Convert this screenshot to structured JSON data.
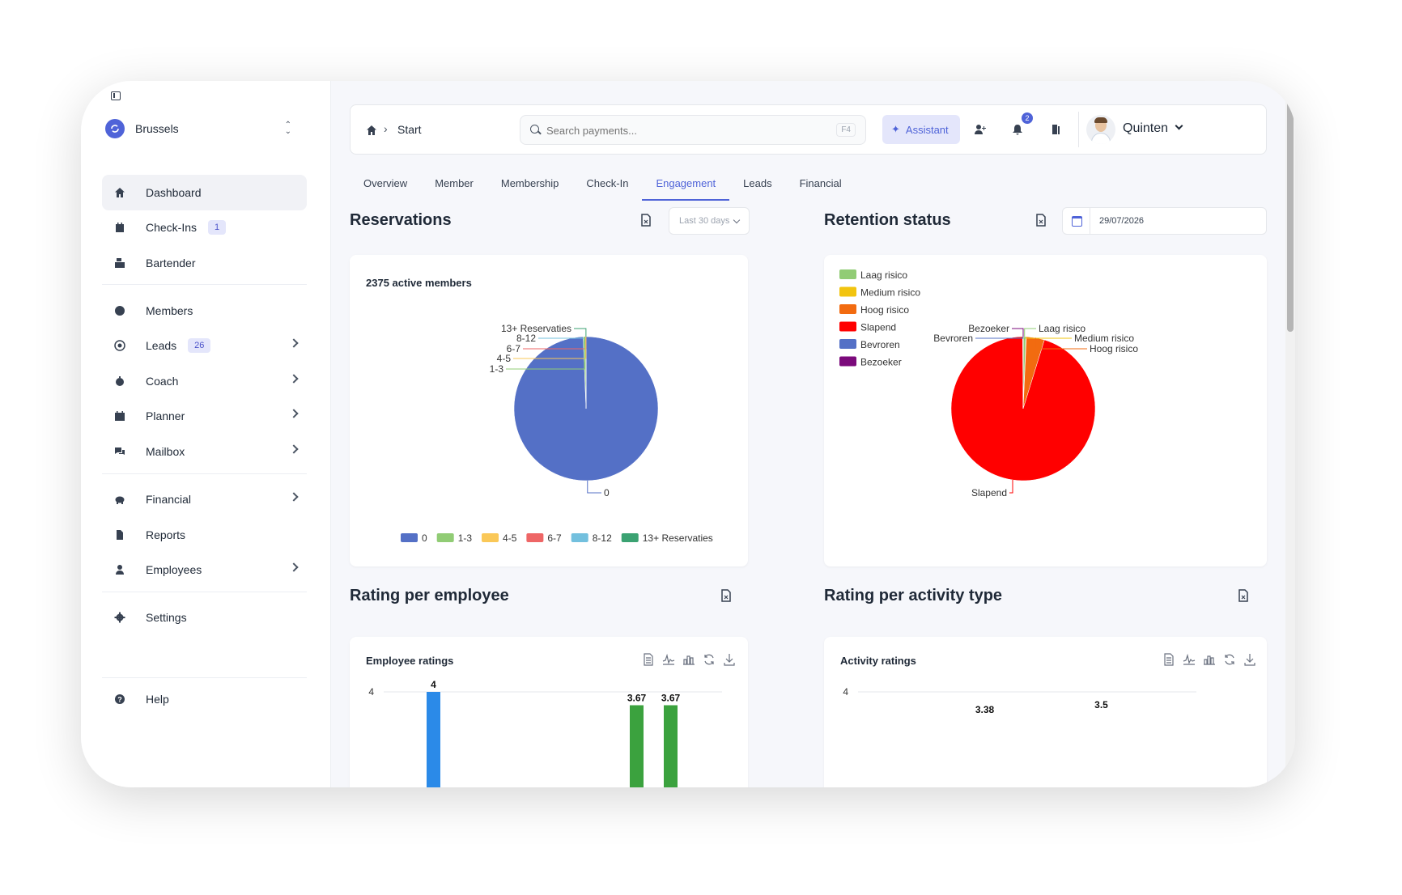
{
  "sidebar": {
    "location": "Brussels",
    "nav": [
      {
        "label": "Dashboard",
        "icon": "home-icon"
      },
      {
        "label": "Check-Ins",
        "icon": "calendar-check-icon",
        "badge": "1"
      },
      {
        "label": "Bartender",
        "icon": "register-icon"
      },
      {
        "label": "Members",
        "icon": "user-circle-icon"
      },
      {
        "label": "Leads",
        "icon": "target-icon",
        "badge": "26"
      },
      {
        "label": "Coach",
        "icon": "stopwatch-icon"
      },
      {
        "label": "Planner",
        "icon": "calendar-icon"
      },
      {
        "label": "Mailbox",
        "icon": "chat-icon"
      },
      {
        "label": "Financial",
        "icon": "piggy-bank-icon"
      },
      {
        "label": "Reports",
        "icon": "file-icon"
      },
      {
        "label": "Employees",
        "icon": "user-tie-icon"
      },
      {
        "label": "Settings",
        "icon": "gear-icon"
      },
      {
        "label": "Help",
        "icon": "question-circle-icon"
      }
    ]
  },
  "topbar": {
    "breadcrumb": "Start",
    "search_placeholder": "Search payments...",
    "search_shortcut": "F4",
    "assistant_label": "Assistant",
    "notification_count": "2",
    "user_name": "Quinten"
  },
  "tabs": [
    "Overview",
    "Member",
    "Membership",
    "Check-In",
    "Engagement",
    "Leads",
    "Financial"
  ],
  "active_tab": "Engagement",
  "reservations": {
    "title": "Reservations",
    "period": "Last 30 days",
    "card_title": "2375 active members"
  },
  "retention": {
    "title": "Retention status",
    "date": "29/07/2026"
  },
  "rating_employee": {
    "title": "Rating per employee",
    "card_title": "Employee ratings"
  },
  "rating_activity": {
    "title": "Rating per activity type",
    "card_title": "Activity ratings"
  },
  "chart_data": [
    {
      "type": "pie",
      "title": "2375 active members",
      "categories": [
        "0",
        "1-3",
        "4-5",
        "6-7",
        "8-12",
        "13+ Reservaties"
      ],
      "values": [
        2360,
        14,
        0,
        0,
        0,
        1
      ],
      "colors": [
        "#5470c6",
        "#91cc75",
        "#fac858",
        "#ee6666",
        "#73c0de",
        "#3ba272"
      ],
      "legend": "bottom"
    },
    {
      "type": "pie",
      "categories": [
        "Laag risico",
        "Medium risico",
        "Hoog risico",
        "Slapend",
        "Bevroren",
        "Bezoeker"
      ],
      "values": [
        6,
        1,
        40,
        938,
        1,
        0
      ],
      "colors": [
        "#91cc75",
        "#f2c40f",
        "#f26b10",
        "#ff0000",
        "#5470c6",
        "#7b0a7b"
      ],
      "legend": "top-left"
    },
    {
      "type": "bar",
      "title": "Employee ratings",
      "values": [
        4,
        3.67,
        3.67
      ],
      "ylim": [
        0,
        4
      ],
      "ticks": [
        "4"
      ],
      "colors": [
        "#2b8ae8",
        "#3ba23e",
        "#3ba23e"
      ]
    },
    {
      "type": "bar",
      "title": "Activity ratings",
      "values": [
        3.38,
        3.5
      ],
      "data_labels": [
        "3.38",
        "3.5"
      ],
      "ylim": [
        0,
        4
      ],
      "ticks": [
        "4"
      ]
    }
  ]
}
